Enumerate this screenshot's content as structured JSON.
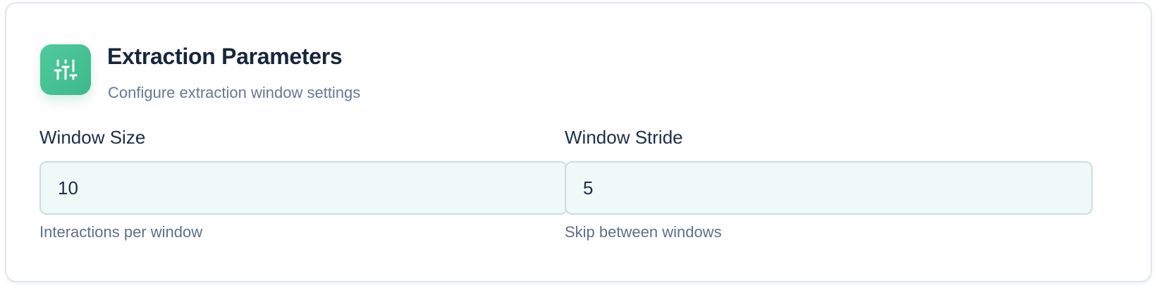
{
  "header": {
    "icon": "sliders-icon",
    "title": "Extraction Parameters",
    "subtitle": "Configure extraction window settings"
  },
  "fields": [
    {
      "label": "Window Size",
      "value": "10",
      "hint": "Interactions per window"
    },
    {
      "label": "Window Stride",
      "value": "5",
      "hint": "Skip between windows"
    }
  ],
  "colors": {
    "accent": "#45c195",
    "input_bg": "#eff9f7",
    "input_border": "#c8e0db",
    "title": "#16263d",
    "muted": "#667892"
  }
}
